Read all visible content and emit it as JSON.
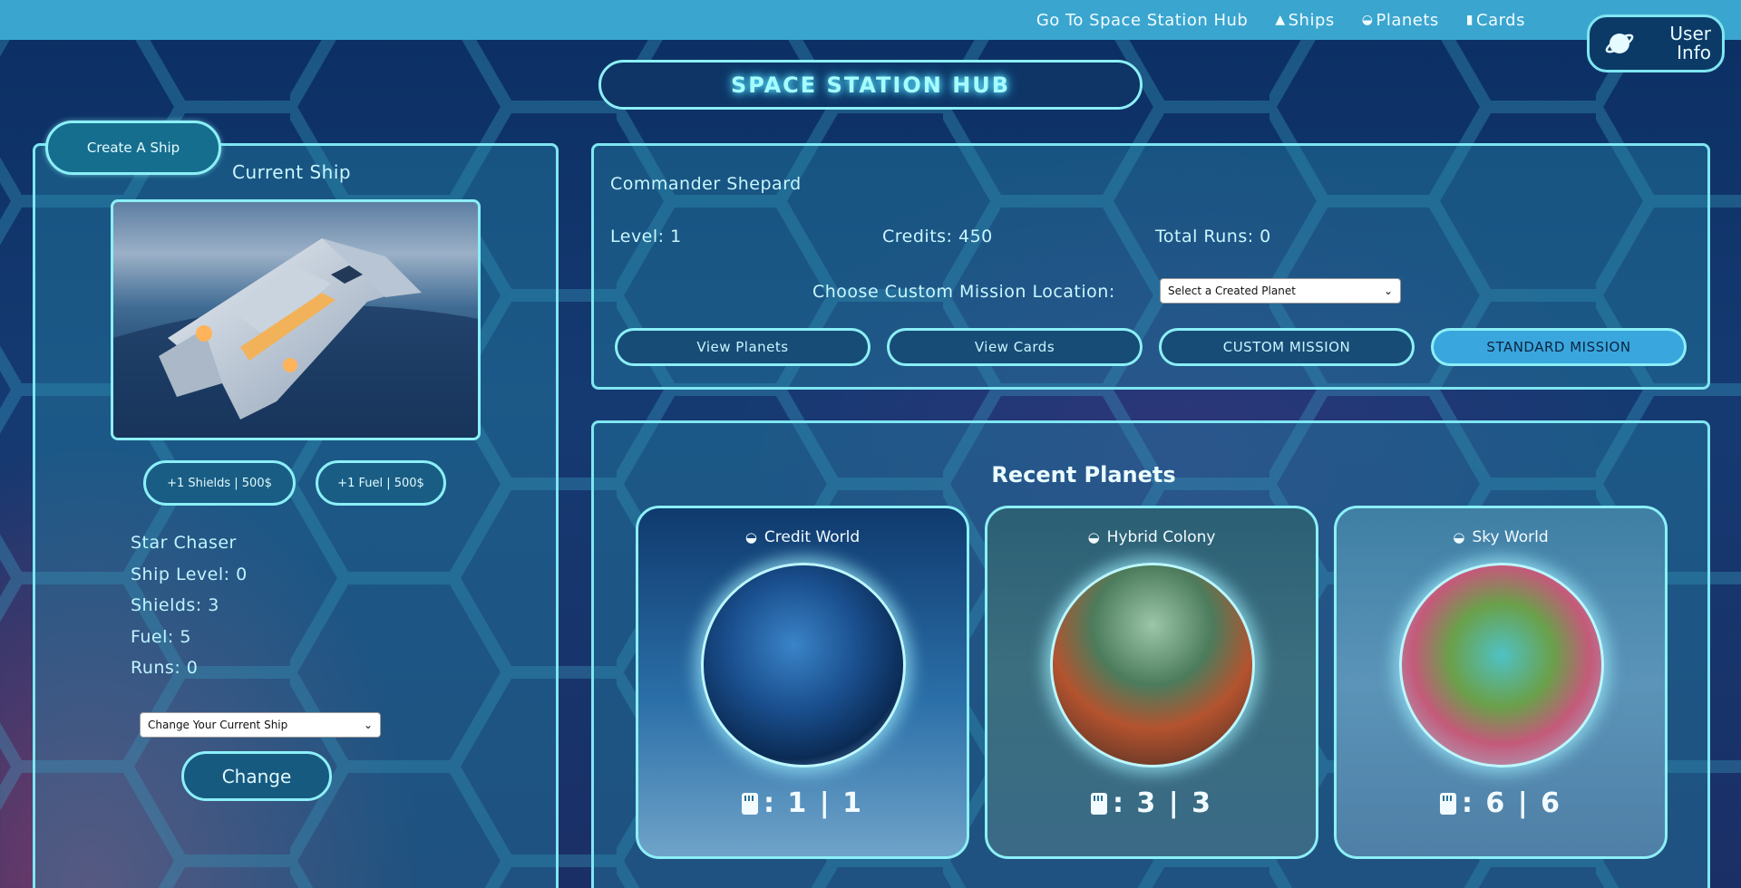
{
  "nav": {
    "links": [
      {
        "label": "Go To Space Station Hub",
        "icon": ""
      },
      {
        "label": "Ships",
        "icon": "rocket-icon"
      },
      {
        "label": "Planets",
        "icon": "planet-icon"
      },
      {
        "label": "Cards",
        "icon": "card-icon"
      }
    ],
    "user_info": "User\nInfo"
  },
  "hub_title": "SPACE STATION HUB",
  "ship_panel": {
    "create_button": "Create A Ship",
    "heading": "Current Ship",
    "upgrades": [
      "+1 Shields | 500$",
      "+1 Fuel | 500$"
    ],
    "name": "Star Chaser",
    "level": "Ship Level: 0",
    "shields": "Shields: 3",
    "fuel": "Fuel: 5",
    "runs": "Runs: 0",
    "select_value": "Change Your Current Ship",
    "change_button": "Change"
  },
  "commander": {
    "name": "Commander Shepard",
    "level": "Level: 1",
    "credits": "Credits: 450",
    "total_runs": "Total Runs: 0",
    "mission_label": "Choose Custom Mission Location:",
    "mission_select": "Select a Created Planet",
    "buttons": [
      "View Planets",
      "View Cards",
      "CUSTOM MISSION",
      "STANDARD MISSION"
    ]
  },
  "recent_planets": {
    "heading": "Recent Planets",
    "planets": [
      {
        "name": "Credit World",
        "count": ": 1 | 1"
      },
      {
        "name": "Hybrid Colony",
        "count": ": 3 | 3"
      },
      {
        "name": "Sky World",
        "count": ": 6 | 6"
      }
    ]
  },
  "colors": {
    "nav": "#3aa6cf",
    "accent_border": "#7fe6f2",
    "primary_button": "#3aa6de",
    "glow_text": "#a6fbff"
  }
}
